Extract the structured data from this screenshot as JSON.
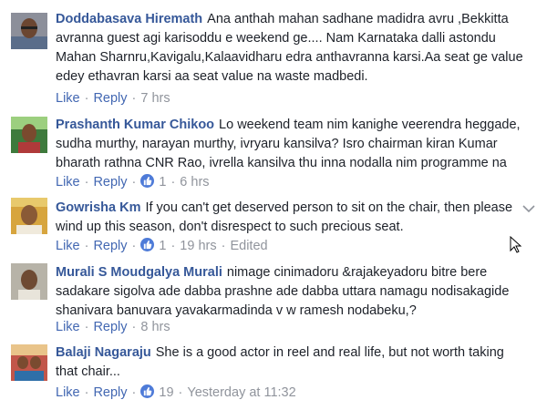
{
  "actions": {
    "like": "Like",
    "reply": "Reply",
    "separator": "·"
  },
  "comments": [
    {
      "author": "Doddabasava Hiremath",
      "body": "Ana anthah mahan sadhane madidra avru ,Bekkitta avranna guest agi karisoddu e weekend ge.... Nam Karnataka dalli astondu Mahan Sharnru,Kavigalu,Kalaavidharu edra anthavranna karsi.Aa seat ge value edey ethavran karsi aa seat value na waste madbedi.",
      "like_count": "",
      "time": "7 hrs",
      "edited": ""
    },
    {
      "author": "Prashanth Kumar Chikoo",
      "body": "Lo weekend team nim kanighe veerendra heggade, sudha murthy, narayan murthy, ivryaru kansilva? Isro chairman kiran Kumar bharath rathna CNR Rao, ivrella kansilva thu inna nodalla nim programme na",
      "like_count": "1",
      "time": "6 hrs",
      "edited": ""
    },
    {
      "author": "Gowrisha Km",
      "body": "If you can't get deserved person to sit on the chair, then please wind up this season, don't disrespect to such precious seat.",
      "like_count": "1",
      "time": "19 hrs",
      "edited": "Edited"
    },
    {
      "author": "Murali S Moudgalya Murali",
      "body": "nimage cinimadoru &rajakeyadoru bitre bere sadakare sigolva ade dabba prashne ade dabba uttara namagu nodisakagide shanivara banuvara yavakarmadinda v w ramesh nodabeku,?",
      "like_count": "",
      "time": "8 hrs",
      "edited": ""
    },
    {
      "author": "Balaji Nagaraju",
      "body": "She is a good actor in reel and real life, but not worth taking that chair...",
      "like_count": "19",
      "time": "Yesterday at 11:32",
      "edited": ""
    }
  ],
  "icons": {
    "reaction": "thumbs-up-icon",
    "options": "chevron-down-icon",
    "pointer": "mouse-cursor-icon"
  },
  "colors": {
    "author": "#365899",
    "action_link": "#4267b2",
    "meta_text": "#90949c",
    "body_text": "#1d2129",
    "reaction_badge": "#4e7bd8"
  }
}
